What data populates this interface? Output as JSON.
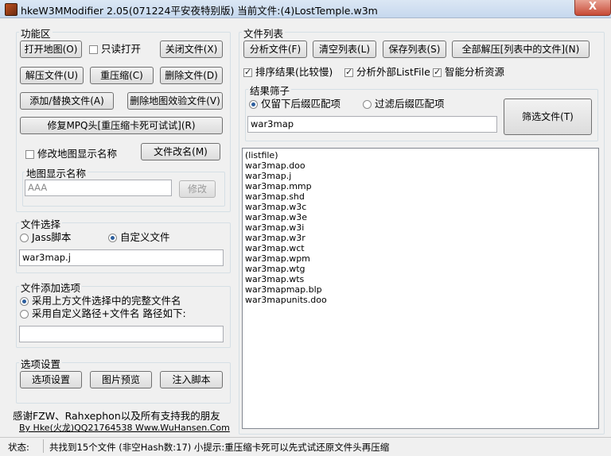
{
  "window": {
    "title": "hkeW3MModifier 2.05(071224平安夜特别版) 当前文件:(4)LostTemple.w3m",
    "close_label": "X"
  },
  "func": {
    "group_label": "功能区",
    "open_map": "打开地图(O)",
    "readonly_open": "只读打开",
    "close_file": "关闭文件(X)",
    "extract_file": "解压文件(U)",
    "recompress": "重压缩(C)",
    "delete_file": "删除文件(D)",
    "add_replace": "添加/替换文件(A)",
    "remove_verify": "删除地图效验文件(V)",
    "fix_mpq": "修复MPQ头[重压缩卡死可试试](R)",
    "modify_display_name": "修改地图显示名称",
    "rename_file": "文件改名(M)",
    "display_name_label": "地图显示名称",
    "display_name_value": "AAA",
    "modify_btn": "修改"
  },
  "file_select": {
    "group_label": "文件选择",
    "jass": "Jass脚本",
    "custom": "自定义文件",
    "value": "war3map.j"
  },
  "add_options": {
    "group_label": "文件添加选项",
    "opt1": "采用上方文件选择中的完整文件名",
    "opt2": "采用自定义路径+文件名 路径如下:",
    "path_value": ""
  },
  "settings": {
    "group_label": "选项设置",
    "options": "选项设置",
    "preview": "图片预览",
    "inject": "注入脚本"
  },
  "credits": {
    "line1": "感谢FZW、Rahxephon以及所有支持我的朋友",
    "line2": "By Hke(火龙)QQ21764538 Www.WuHansen.Com"
  },
  "filelist": {
    "group_label": "文件列表",
    "analyze": "分析文件(F)",
    "clear": "清空列表(L)",
    "save": "保存列表(S)",
    "extract_all": "全部解压[列表中的文件](N)",
    "sort": "排序结果(比较慢)",
    "analyze_ext": "分析外部ListFile",
    "smart": "智能分析资源",
    "filter_label": "结果筛子",
    "keep_suffix": "仅留下后缀匹配项",
    "filter_suffix": "过滤后缀匹配项",
    "filter_value": "war3map",
    "filter_btn": "筛选文件(T)",
    "items": [
      "(listfile)",
      "war3map.doo",
      "war3map.j",
      "war3map.mmp",
      "war3map.shd",
      "war3map.w3c",
      "war3map.w3e",
      "war3map.w3i",
      "war3map.w3r",
      "war3map.wct",
      "war3map.wpm",
      "war3map.wtg",
      "war3map.wts",
      "war3mapmap.blp",
      "war3mapunits.doo"
    ]
  },
  "status": {
    "label": "状态:",
    "text": "共找到15个文件 (非空Hash数:17) 小提示:重压缩卡死可以先式试还原文件头再压缩"
  }
}
